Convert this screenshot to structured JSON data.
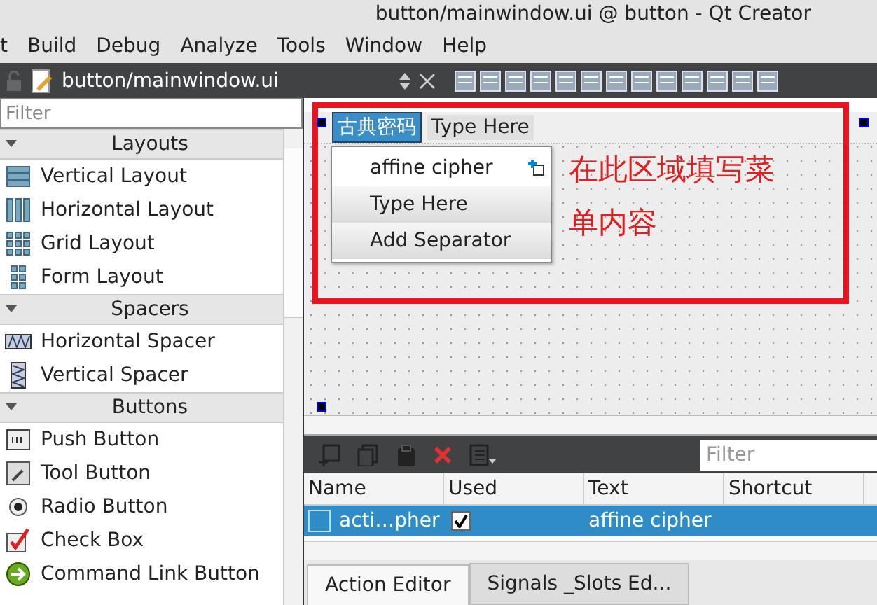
{
  "window": {
    "title": "button/mainwindow.ui @ button - Qt Creator"
  },
  "menu_bar": [
    "t",
    "Build",
    "Debug",
    "Analyze",
    "Tools",
    "Window",
    "Help"
  ],
  "editor_tab": {
    "file": "button/mainwindow.ui"
  },
  "widget_box": {
    "filter": {
      "placeholder": "Filter"
    },
    "groups": [
      {
        "title": "Layouts",
        "expanded": true,
        "items": [
          "Vertical Layout",
          "Horizontal Layout",
          "Grid Layout",
          "Form Layout"
        ]
      },
      {
        "title": "Spacers",
        "expanded": true,
        "items": [
          "Horizontal Spacer",
          "Vertical Spacer"
        ]
      },
      {
        "title": "Buttons",
        "expanded": true,
        "items": [
          "Push Button",
          "Tool Button",
          "Radio Button",
          "Check Box",
          "Command Link Button"
        ]
      }
    ]
  },
  "form": {
    "menus": [
      {
        "label": "古典密码",
        "selected": true
      },
      {
        "label": "Type Here",
        "selected": false
      }
    ],
    "dropdown": [
      {
        "label": "affine cipher",
        "kind": "action"
      },
      {
        "label": "Type Here",
        "kind": "placeholder"
      },
      {
        "label": "Add Separator",
        "kind": "placeholder"
      }
    ],
    "annotation": "在此区域填写菜单内容"
  },
  "action_editor": {
    "filter": {
      "placeholder": "Filter"
    },
    "columns": [
      "Name",
      "Used",
      "Text",
      "Shortcut"
    ],
    "rows": [
      {
        "name": "acti…pher",
        "used": true,
        "text": "affine cipher",
        "selected": true
      }
    ]
  },
  "tabs": [
    {
      "label": "Action Editor",
      "selected": true
    },
    {
      "label": "Signals _Slots Ed...",
      "selected": false
    }
  ]
}
